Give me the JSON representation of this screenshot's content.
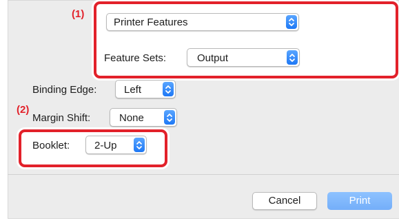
{
  "annotations": {
    "step1": "(1)",
    "step2": "(2)"
  },
  "preset_menu": {
    "value": "Printer Features"
  },
  "feature_sets": {
    "label": "Feature Sets:",
    "value": "Output"
  },
  "binding_edge": {
    "label": "Binding Edge:",
    "value": "Left"
  },
  "margin_shift": {
    "label": "Margin Shift:",
    "value": "None"
  },
  "booklet": {
    "label": "Booklet:",
    "value": "2-Up"
  },
  "buttons": {
    "cancel": "Cancel",
    "print": "Print"
  },
  "colors": {
    "callout": "#e2212a",
    "accent": "#1e78f5",
    "print_button": "#74aef9"
  }
}
